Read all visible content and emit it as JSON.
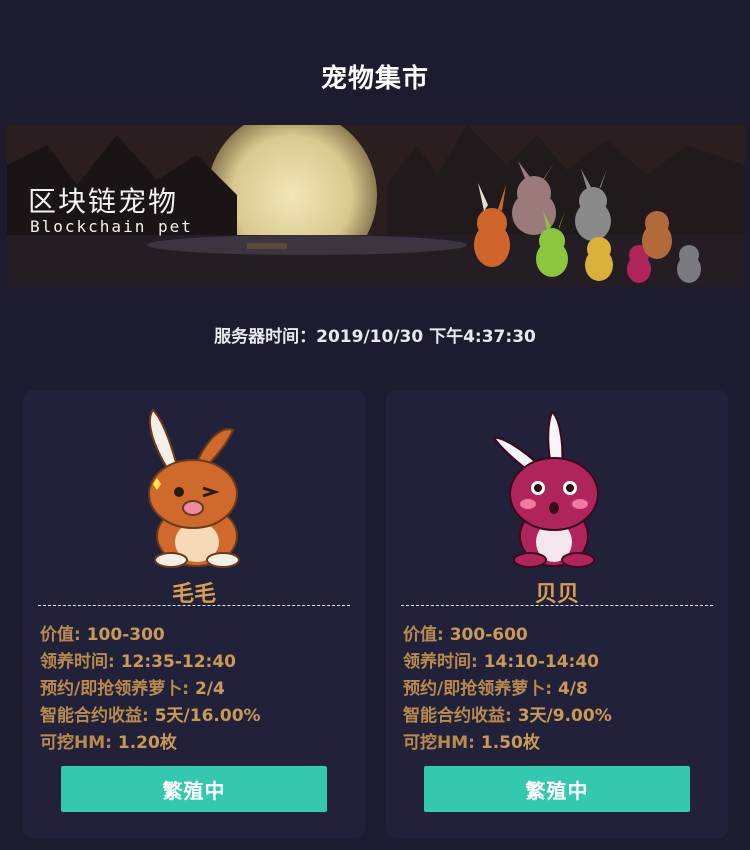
{
  "header": {
    "title": "宠物集市"
  },
  "banner": {
    "title": "区块链宠物",
    "subtitle": "Blockchain pet"
  },
  "server_time": {
    "text": "服务器时间：2019/10/30 下午4:37:30"
  },
  "pets": [
    {
      "name": "毛毛",
      "value_label": "价值: ",
      "value": "100-300",
      "adopt_label": "领养时间: ",
      "adopt_time": "12:35-12:40",
      "reserve_label": "预约/即抢领养萝卜: ",
      "reserve": "2/4",
      "income_label": "智能合约收益: ",
      "income": "5天/16.00%",
      "mine_label": "可挖HM: ",
      "mine": "1.20枚",
      "button": "繁殖中",
      "color": "#d06a2c"
    },
    {
      "name": "贝贝",
      "value_label": "价值: ",
      "value": "300-600",
      "adopt_label": "领养时间: ",
      "adopt_time": "14:10-14:40",
      "reserve_label": "预约/即抢领养萝卜: ",
      "reserve": "4/8",
      "income_label": "智能合约收益: ",
      "income": "3天/9.00%",
      "mine_label": "可挖HM: ",
      "mine": "1.50枚",
      "button": "繁殖中",
      "color": "#b0245c"
    }
  ]
}
